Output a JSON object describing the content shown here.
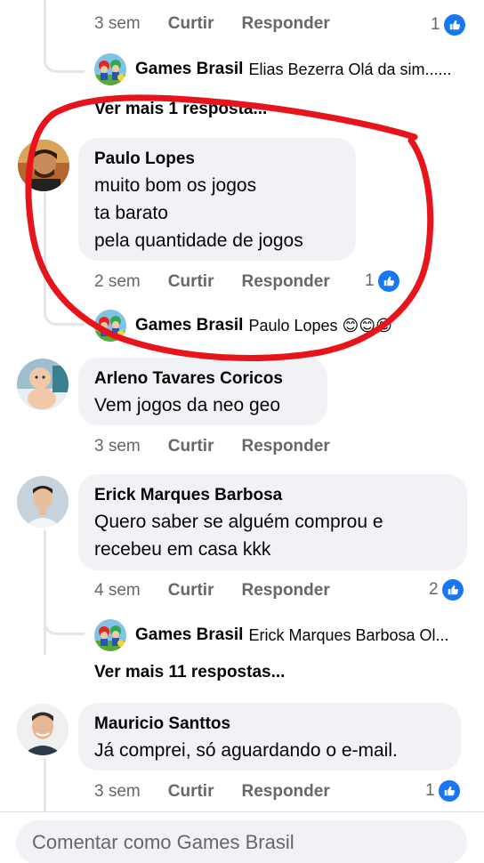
{
  "top_partial": {
    "time": "3 sem",
    "like": "Curtir",
    "reply": "Responder",
    "count": "1"
  },
  "thread_top": {
    "reply_preview": {
      "author": "Games Brasil",
      "text": "Elias Bezerra Olá da sim......"
    },
    "more_replies": "Ver mais 1 resposta..."
  },
  "comments": [
    {
      "author": "Paulo Lopes",
      "text": "muito bom os jogos\nta barato\npela quantidade de jogos",
      "time": "2 sem",
      "like": "Curtir",
      "reply": "Responder",
      "reactions": "1",
      "reply_preview": {
        "author": "Games Brasil",
        "text": "Paulo Lopes 😊😊😊"
      }
    },
    {
      "author": "Arleno Tavares Coricos",
      "text": "Vem jogos da neo geo",
      "time": "3 sem",
      "like": "Curtir",
      "reply": "Responder"
    },
    {
      "author": "Erick Marques Barbosa",
      "text": "Quero saber se alguém comprou e\nrecebeu em casa kkk",
      "time": "4 sem",
      "like": "Curtir",
      "reply": "Responder",
      "reactions": "2",
      "reply_preview": {
        "author": "Games Brasil",
        "text": "Erick Marques Barbosa Ol..."
      },
      "more_replies": "Ver mais 11 respostas..."
    },
    {
      "author": "Mauricio Santtos",
      "text": "Já comprei, só aguardando o e-mail.",
      "time": "3 sem",
      "like": "Curtir",
      "reply": "Responder",
      "reactions": "1"
    }
  ],
  "composer": {
    "placeholder": "Comentar como Games Brasil"
  },
  "colors": {
    "like_blue": "#1877f2",
    "bubble_bg": "#f0f2f5",
    "annotation_red": "#e8141c",
    "meta_gray": "#65676b"
  },
  "icons": {
    "like": "thumbs-up-icon",
    "page_avatar": "mario-characters-avatar"
  }
}
